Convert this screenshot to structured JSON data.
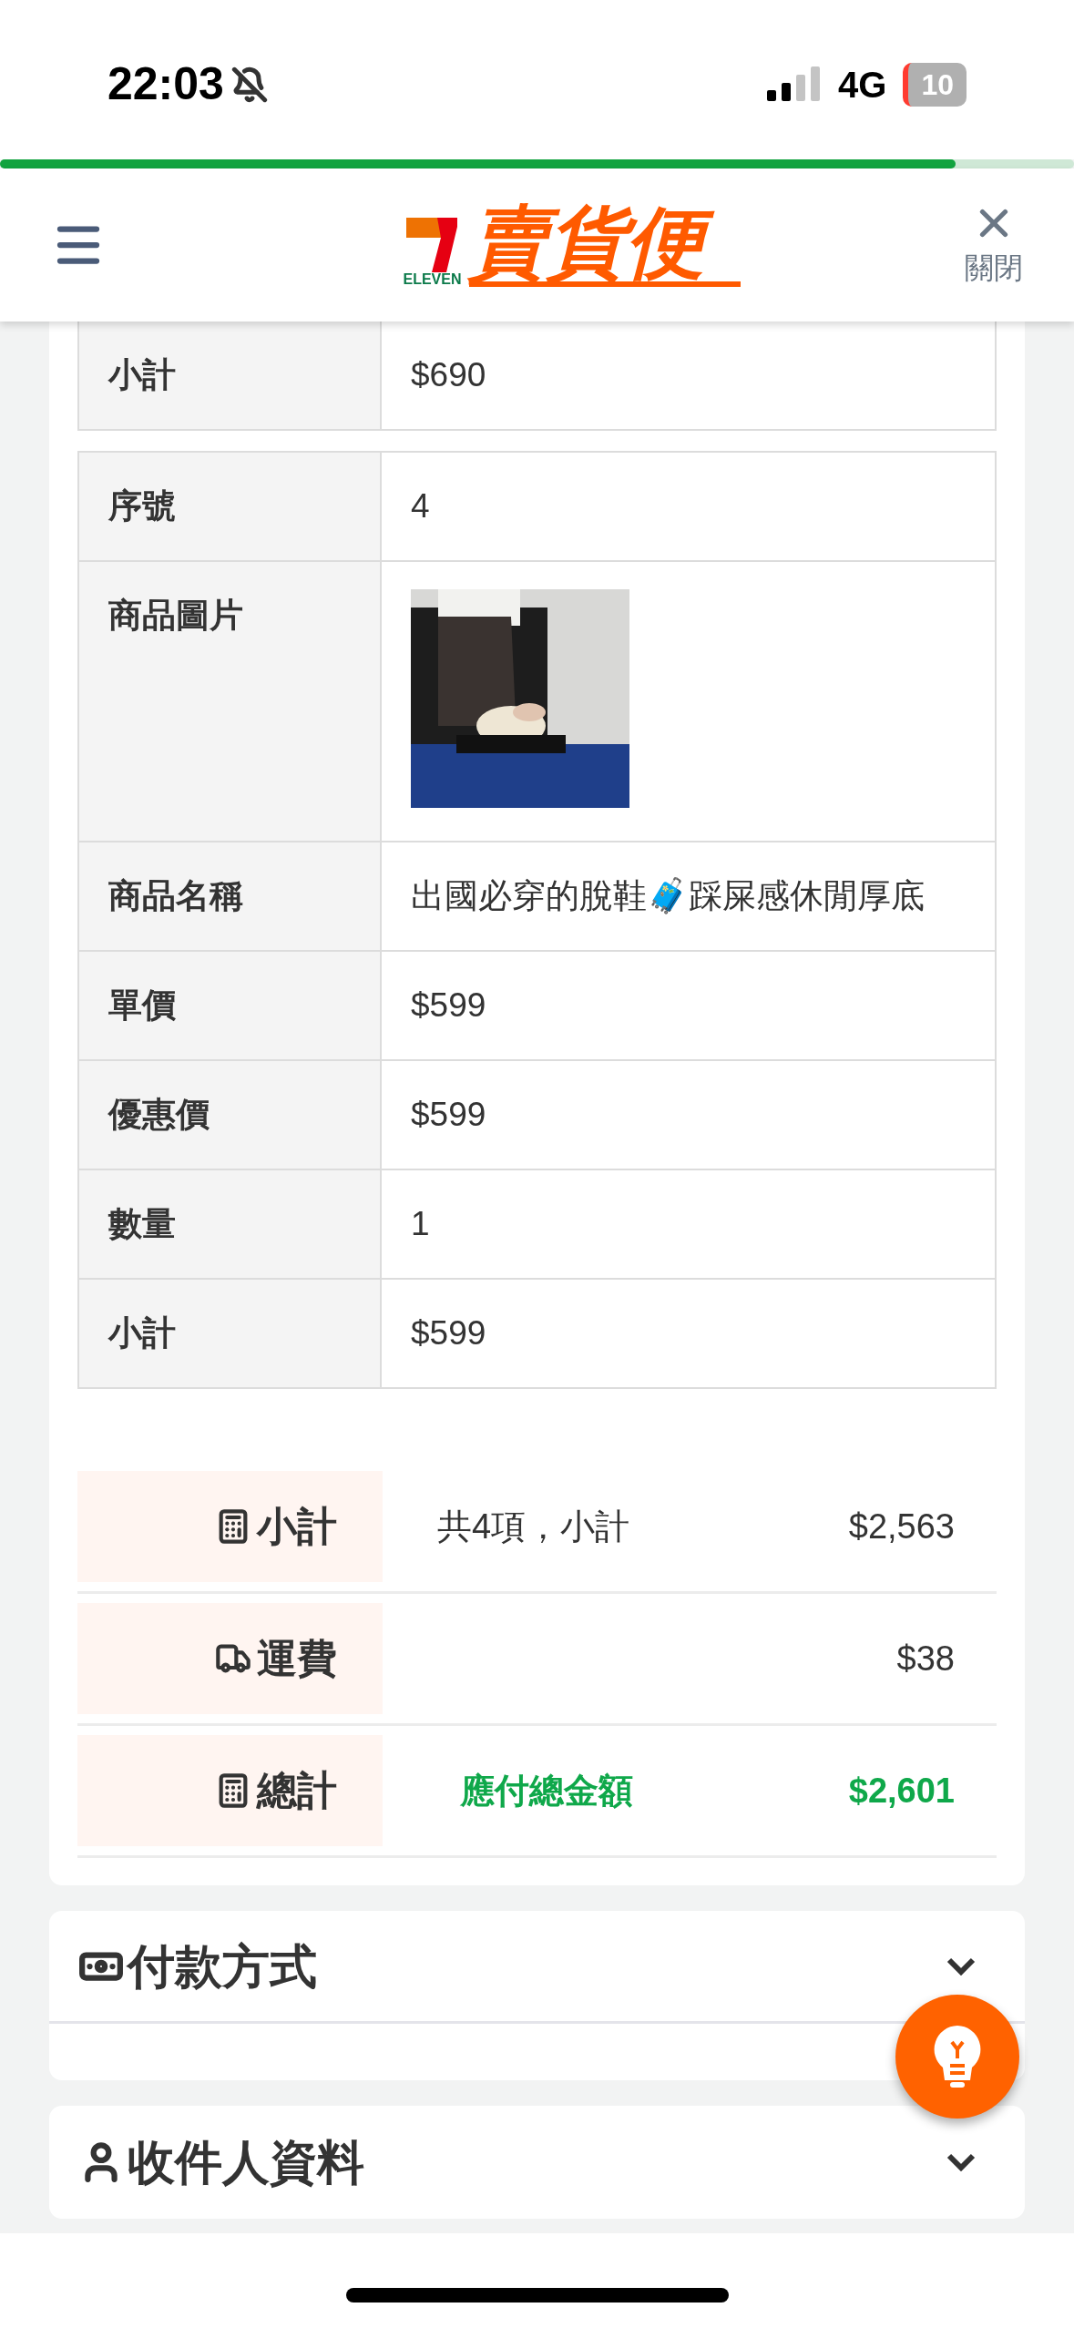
{
  "status_bar": {
    "time": "22:03",
    "network": "4G",
    "battery": "10"
  },
  "progress": {
    "level": 0.89
  },
  "header": {
    "logo_mark": "ELEVEN",
    "logo_name": "賣貨便",
    "close_label": "關閉"
  },
  "items": [
    {
      "rows": [
        {
          "label": "小計",
          "value": "$690"
        }
      ]
    },
    {
      "rows": [
        {
          "label": "序號",
          "value": "4"
        },
        {
          "label": "商品圖片",
          "kind": "picture"
        },
        {
          "label": "商品名稱",
          "value": "出國必穿的脫鞋🧳踩屎感休閒厚底"
        },
        {
          "label": "單價",
          "value": "$599"
        },
        {
          "label": "優惠價",
          "value": "$599"
        },
        {
          "label": "數量",
          "value": "1"
        },
        {
          "label": "小計",
          "value": "$599"
        }
      ]
    }
  ],
  "summary": [
    {
      "kind": "subtotal",
      "label": "小計",
      "note": "共4項，小計",
      "amount": "$2,563",
      "highlight": false
    },
    {
      "kind": "shipping",
      "label": "運費",
      "amount": "$38",
      "highlight": false
    },
    {
      "kind": "total",
      "label": "總計",
      "note": "應付總金額",
      "amount": "$2,601",
      "highlight": true
    }
  ],
  "sections": [
    {
      "kind": "payment",
      "title": "付款方式",
      "expanded": true
    },
    {
      "kind": "recipient",
      "title": "收件人資料",
      "expanded": false
    }
  ]
}
